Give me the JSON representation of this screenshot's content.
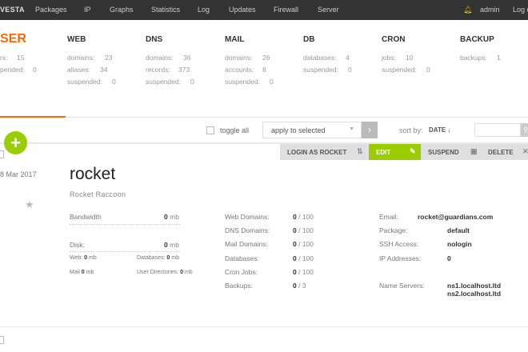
{
  "nav": {
    "logo": "VESTA",
    "items": [
      "Packages",
      "IP",
      "Graphs",
      "Statistics",
      "Log",
      "Updates",
      "Firewall",
      "Server"
    ],
    "user": "admin",
    "logout": "Log out"
  },
  "summary": {
    "user": {
      "title": "SER",
      "rows": [
        {
          "label": "rs:",
          "value": "15"
        },
        {
          "label": "pended:",
          "value": "0"
        }
      ]
    },
    "web": {
      "title": "WEB",
      "rows": [
        {
          "label": "domains:",
          "value": "23"
        },
        {
          "label": "aliases:",
          "value": "34"
        },
        {
          "label": "suspended:",
          "value": "0"
        }
      ]
    },
    "dns": {
      "title": "DNS",
      "rows": [
        {
          "label": "domains:",
          "value": "36"
        },
        {
          "label": "records:",
          "value": "373"
        },
        {
          "label": "suspended:",
          "value": "0"
        }
      ]
    },
    "mail": {
      "title": "MAIL",
      "rows": [
        {
          "label": "domains:",
          "value": "26"
        },
        {
          "label": "accounts:",
          "value": "8"
        },
        {
          "label": "suspended:",
          "value": "0"
        }
      ]
    },
    "db": {
      "title": "DB",
      "rows": [
        {
          "label": "databases:",
          "value": "4"
        },
        {
          "label": "suspended:",
          "value": "0"
        }
      ]
    },
    "cron": {
      "title": "CRON",
      "rows": [
        {
          "label": "jobs:",
          "value": "10"
        },
        {
          "label": "suspended:",
          "value": "0"
        }
      ]
    },
    "backup": {
      "title": "BACKUP",
      "rows": [
        {
          "label": "backups:",
          "value": "1"
        }
      ]
    }
  },
  "toolbar": {
    "toggle_all": "toggle all",
    "select_value": "apply to selected",
    "sort_label": "sort by:",
    "sort_value": "DATE ↓"
  },
  "actions": {
    "login": "LOGIN AS ROCKET",
    "edit": "EDIT",
    "suspend": "SUSPEND",
    "delete": "DELETE"
  },
  "user": {
    "date": "8  Mar  2017",
    "username": "rocket",
    "fullname": "Rocket Raccoon",
    "bandwidth_label": "Bandwidth",
    "bandwidth_value": "0",
    "disk_label": "Disk:",
    "disk_value": "0",
    "unit": "mb",
    "web_label": "Web:",
    "web_value": "0",
    "db_label": "Databases:",
    "db_value": "0",
    "mail_label": "Mail",
    "mail_value": "0",
    "userdir_label": "User Directories:",
    "userdir_value": "0",
    "stats": [
      {
        "label": "Web Domains:",
        "used": "0",
        "total": "/ 100"
      },
      {
        "label": "DNS Domains:",
        "used": "0",
        "total": "/ 100"
      },
      {
        "label": "Mail Domains:",
        "used": "0",
        "total": "/ 100"
      },
      {
        "label": "Databases:",
        "used": "0",
        "total": "/ 100"
      },
      {
        "label": "Cron Jobs:",
        "used": "0",
        "total": "/ 100"
      },
      {
        "label": "Backups:",
        "used": "0",
        "total": "/ 3"
      }
    ],
    "email_label": "Email:",
    "email_value": "rocket@guardians.com",
    "package_label": "Package:",
    "package_value": "default",
    "ssh_label": "SSH Access:",
    "ssh_value": "nologin",
    "ip_label": "IP Addresses:",
    "ip_value": "0",
    "ns_label": "Name Servers:",
    "ns1": "ns1.localhost.ltd",
    "ns2": "ns2.localhost.ltd"
  }
}
